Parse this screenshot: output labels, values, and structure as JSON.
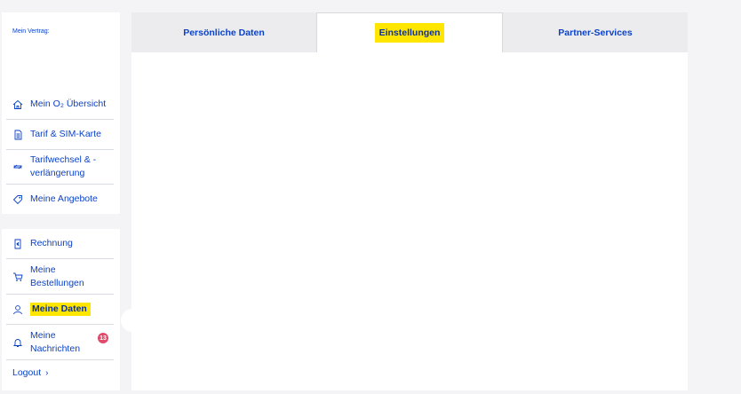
{
  "sidebar": {
    "contract_label": "Mein Vertrag:",
    "main_items": [
      {
        "label": "Mein O₂ Übersicht",
        "icon": "home-icon"
      },
      {
        "label": "Tarif & SIM-Karte",
        "icon": "sim-card-icon"
      },
      {
        "label": "Tarifwechsel & -verlängerung",
        "icon": "swap-arrows-icon"
      },
      {
        "label": "Meine Angebote",
        "icon": "tag-icon"
      }
    ],
    "account_items": [
      {
        "label": "Rechnung",
        "icon": "invoice-icon"
      },
      {
        "label": "Meine Bestellungen",
        "icon": "cart-icon"
      },
      {
        "label": "Meine Daten",
        "icon": "user-icon"
      },
      {
        "label": "Meine Nachrichten",
        "icon": "bell-icon",
        "badge": "13"
      }
    ],
    "logout_label": "Logout"
  },
  "tabs": [
    {
      "label": "Persönliche Daten"
    },
    {
      "label": "Einstellungen"
    },
    {
      "label": "Partner-Services"
    }
  ],
  "colors": {
    "brand_blue": "#0c42c6",
    "highlight": "#ffe600",
    "badge": "#e04a6b"
  }
}
